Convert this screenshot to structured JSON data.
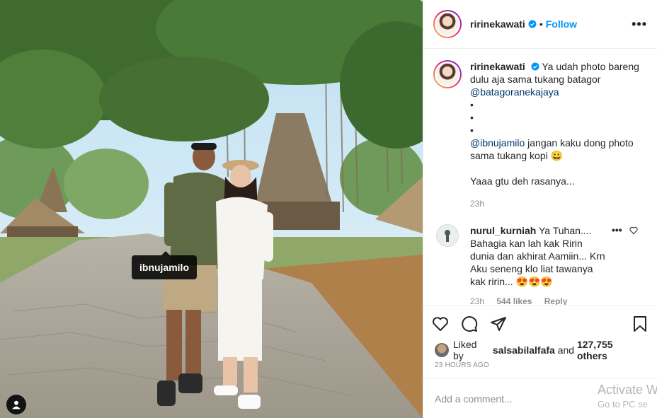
{
  "post": {
    "username": "ririnekawati",
    "follow_label": "Follow",
    "more_label": "•••",
    "dot": "•",
    "photo_tag": "ibnujamilo"
  },
  "caption": {
    "username": "ririnekawati",
    "line1": "Ya udah photo bareng dulu aja sama tukang batagor",
    "mention1": "@batagoranekajaya",
    "bullets": [
      "•",
      "•",
      "•"
    ],
    "mention2": "@ibnujamilo",
    "line2": "jangan kaku dong photo sama tukang kopi 😀",
    "line3": "Yaaa gtu deh rasanya...",
    "time": "23h"
  },
  "comment": {
    "username": "nurul_kurniah",
    "text": "Ya Tuhan.... Bahagia kan lah kak Ririn dunia dan akhirat Aamiin... Krn Aku seneng klo liat tawanya kak ririn... 😍😍😍",
    "time": "23h",
    "likes": "544 likes",
    "reply": "Reply",
    "more": "•••"
  },
  "likes": {
    "prefix": "Liked by",
    "user": "salsabilalfafa",
    "middle": "and",
    "count": "127,755 others"
  },
  "timestamp": "23 HOURS AGO",
  "add_comment_placeholder": "Add a comment...",
  "watermark": {
    "line1": "Activate W",
    "line2": "Go to PC se"
  },
  "icons": {
    "like": "heart-icon",
    "comment": "comment-bubble-icon",
    "share": "paper-plane-icon",
    "save": "bookmark-icon",
    "tags": "user-tag-icon",
    "verified": "verified-badge-icon"
  },
  "colors": {
    "accent": "#0095f6",
    "mention": "#00376b",
    "muted": "#8e8e8e"
  }
}
